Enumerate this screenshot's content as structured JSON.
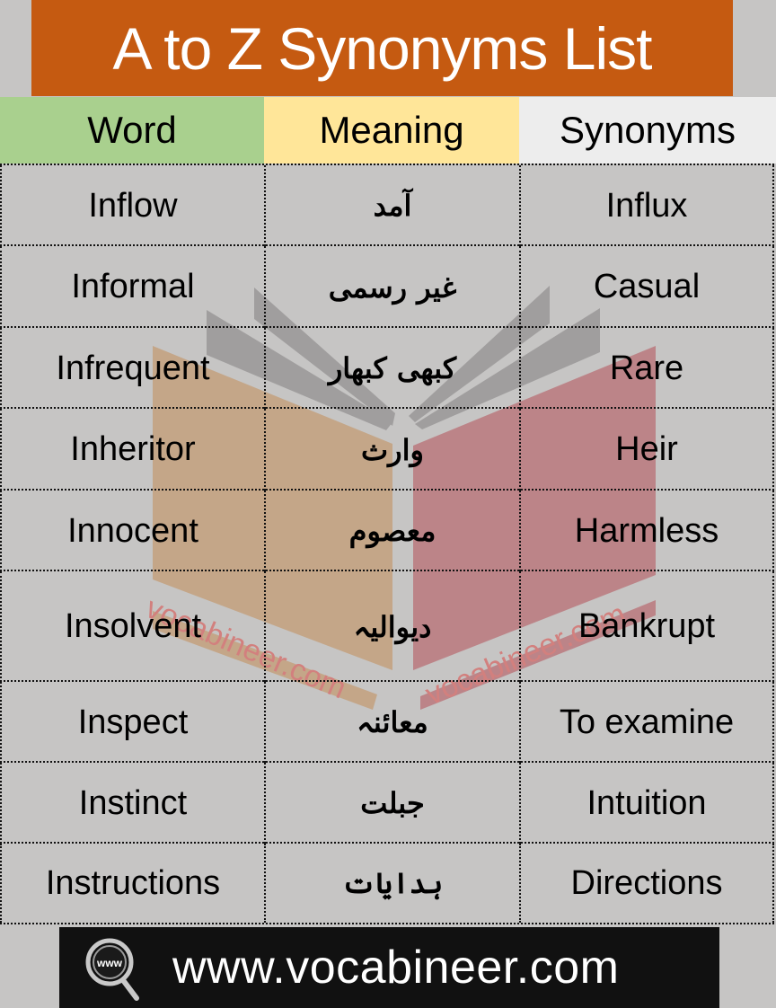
{
  "title": "A to Z Synonyms List",
  "header": {
    "word": "Word",
    "meaning": "Meaning",
    "synonyms": "Synonyms"
  },
  "colors": {
    "title_bg": "#c55a11",
    "word_header_bg": "#a9d08e",
    "meaning_header_bg": "#ffe699",
    "synonyms_header_bg": "#ededed",
    "table_bg": "#c6c5c4",
    "footer_bg": "#111111"
  },
  "rows": [
    {
      "word": "Inflow",
      "meaning": "آمد",
      "synonym": "Influx"
    },
    {
      "word": "Informal",
      "meaning": "غیر رسمی",
      "synonym": "Casual"
    },
    {
      "word": "Infrequent",
      "meaning": "کبھی کبھار",
      "synonym": "Rare"
    },
    {
      "word": "Inheritor",
      "meaning": "وارث",
      "synonym": "Heir"
    },
    {
      "word": "Innocent",
      "meaning": "معصوم",
      "synonym": "Harmless"
    },
    {
      "word": "Insolvent",
      "meaning": "دیوالیہ",
      "synonym": "Bankrupt"
    },
    {
      "word": "Inspect",
      "meaning": "معائنہ",
      "synonym": "To examine"
    },
    {
      "word": "Instinct",
      "meaning": "جبلت",
      "synonym": "Intuition"
    },
    {
      "word": "Instructions",
      "meaning": "ہدایات",
      "synonym": "Directions"
    }
  ],
  "watermark": {
    "text_left": "vocabineer.com",
    "text_right": "vocabineer.com",
    "icon": "open-book-icon"
  },
  "footer": {
    "icon": "www-magnifier-icon",
    "icon_text": "www",
    "url": "www.vocabineer.com"
  }
}
